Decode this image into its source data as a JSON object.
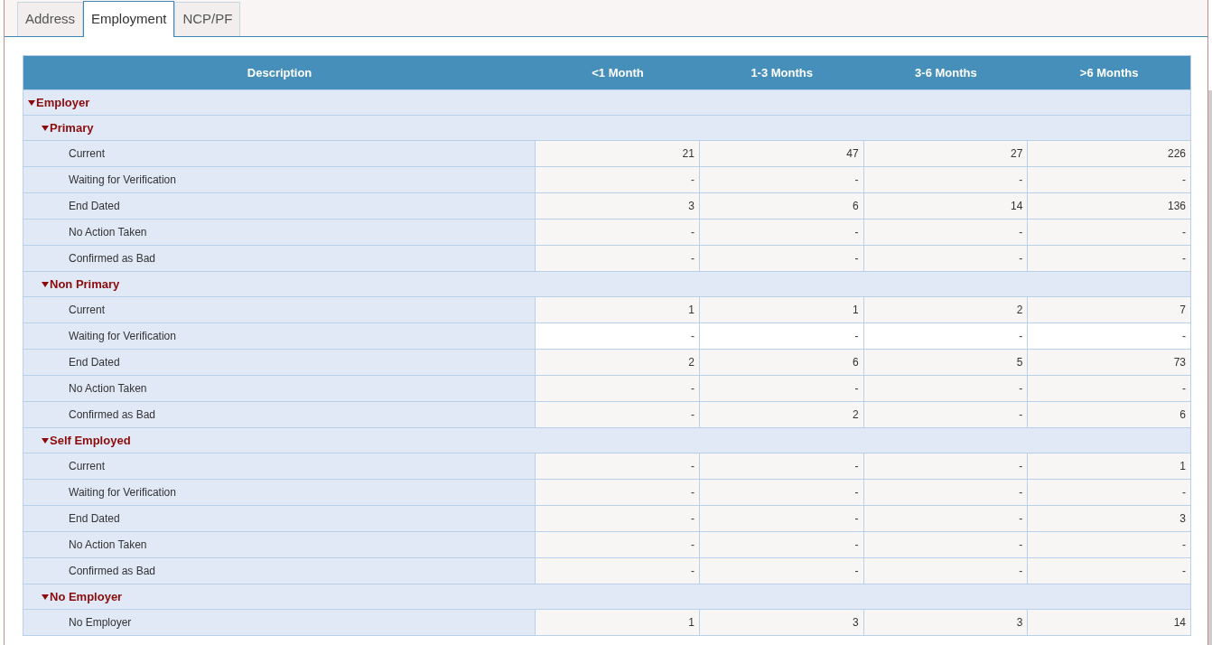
{
  "tabs": [
    {
      "label": "Address",
      "selected": false
    },
    {
      "label": "Employment",
      "selected": true
    },
    {
      "label": "NCP/PF",
      "selected": false
    }
  ],
  "table": {
    "columns": [
      "Description",
      "<1 Month",
      "1-3 Months",
      "3-6 Months",
      ">6 Months"
    ],
    "groups": [
      {
        "label": "Employer",
        "expanded": true,
        "children": [
          {
            "label": "Primary",
            "expanded": true,
            "rows": [
              {
                "label": "Current",
                "values": [
                  "21",
                  "47",
                  "27",
                  "226"
                ],
                "highlighted": false
              },
              {
                "label": "Waiting for Verification",
                "values": [
                  "-",
                  "-",
                  "-",
                  "-"
                ],
                "highlighted": false
              },
              {
                "label": "End Dated",
                "values": [
                  "3",
                  "6",
                  "14",
                  "136"
                ],
                "highlighted": false
              },
              {
                "label": "No Action Taken",
                "values": [
                  "-",
                  "-",
                  "-",
                  "-"
                ],
                "highlighted": false
              },
              {
                "label": "Confirmed as Bad",
                "values": [
                  "-",
                  "-",
                  "-",
                  "-"
                ],
                "highlighted": false
              }
            ]
          },
          {
            "label": "Non Primary",
            "expanded": true,
            "rows": [
              {
                "label": "Current",
                "values": [
                  "1",
                  "1",
                  "2",
                  "7"
                ],
                "highlighted": false
              },
              {
                "label": "Waiting for Verification",
                "values": [
                  "-",
                  "-",
                  "-",
                  "-"
                ],
                "highlighted": true
              },
              {
                "label": "End Dated",
                "values": [
                  "2",
                  "6",
                  "5",
                  "73"
                ],
                "highlighted": false
              },
              {
                "label": "No Action Taken",
                "values": [
                  "-",
                  "-",
                  "-",
                  "-"
                ],
                "highlighted": false
              },
              {
                "label": "Confirmed as Bad",
                "values": [
                  "-",
                  "2",
                  "-",
                  "6"
                ],
                "highlighted": false
              }
            ]
          },
          {
            "label": "Self Employed",
            "expanded": true,
            "rows": [
              {
                "label": "Current",
                "values": [
                  "-",
                  "-",
                  "-",
                  "1"
                ],
                "highlighted": false
              },
              {
                "label": "Waiting for Verification",
                "values": [
                  "-",
                  "-",
                  "-",
                  "-"
                ],
                "highlighted": false
              },
              {
                "label": "End Dated",
                "values": [
                  "-",
                  "-",
                  "-",
                  "3"
                ],
                "highlighted": false
              },
              {
                "label": "No Action Taken",
                "values": [
                  "-",
                  "-",
                  "-",
                  "-"
                ],
                "highlighted": false
              },
              {
                "label": "Confirmed as Bad",
                "values": [
                  "-",
                  "-",
                  "-",
                  "-"
                ],
                "highlighted": false
              }
            ]
          },
          {
            "label": "No Employer",
            "expanded": true,
            "rows": [
              {
                "label": "No Employer",
                "values": [
                  "1",
                  "3",
                  "3",
                  "14"
                ],
                "highlighted": false
              }
            ]
          }
        ]
      }
    ]
  }
}
